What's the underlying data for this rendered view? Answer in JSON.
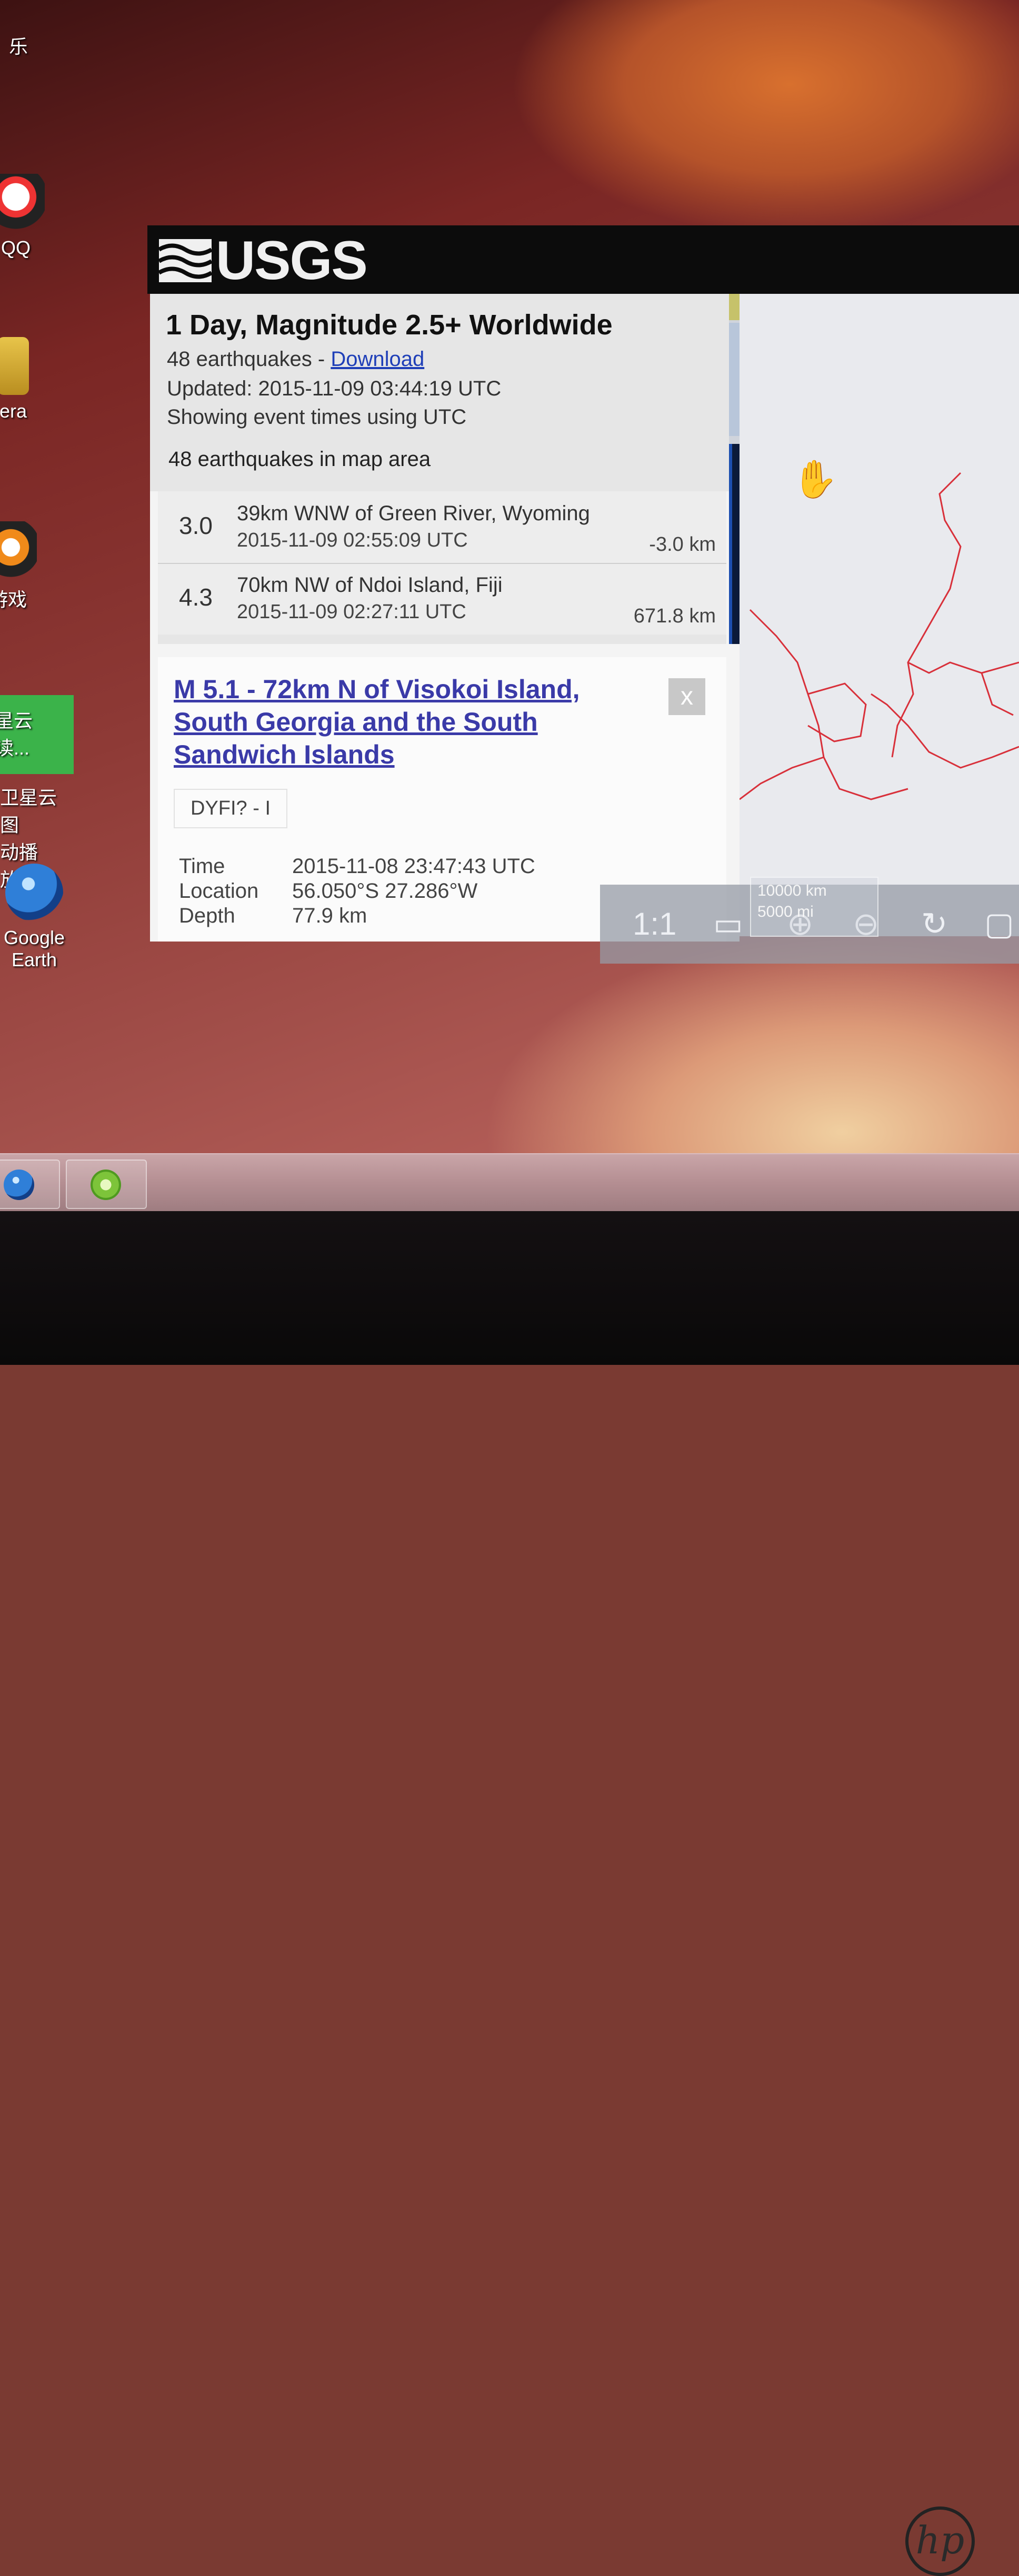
{
  "header": {
    "logo_text": "USGS"
  },
  "summary": {
    "title": "1 Day, Magnitude 2.5+ Worldwide",
    "count_text": "48 earthquakes - ",
    "download_label": "Download",
    "updated": "Updated: 2015-11-09 03:44:19 UTC",
    "timezone_note": "Showing event times using UTC",
    "map_area_count": "48 earthquakes in map area"
  },
  "events": [
    {
      "mag": "3.0",
      "place": "39km WNW of Green River, Wyoming",
      "time": "2015-11-09 02:55:09 UTC",
      "depth": "-3.0 km"
    },
    {
      "mag": "4.3",
      "place": "70km NW of Ndoi Island, Fiji",
      "time": "2015-11-09 02:27:11 UTC",
      "depth": "671.8 km"
    }
  ],
  "popup": {
    "title": "M 5.1 - 72km N of Visokoi Island, South Georgia and the South Sandwich Islands",
    "close_label": "x",
    "dyfi": "DYFI? - I",
    "time_label": "Time",
    "time_value": "2015-11-08 23:47:43 UTC",
    "location_label": "Location",
    "location_value": "56.050°S 27.286°W",
    "depth_label": "Depth",
    "depth_value": "77.9 km"
  },
  "map_controls": {
    "one_to_one": "1:1",
    "scale_km": "10000 km",
    "scale_mi": "5000 mi"
  },
  "desktop_icons": {
    "icon1": "乐",
    "icon2": "QQ",
    "icon3": "era",
    "icon4": "游戏",
    "icon5_line1": "星云",
    "icon5_line2": "读...",
    "icon6_line1": "卫星云图",
    "icon6_line2": "动播放'",
    "icon7_line1": "Google",
    "icon7_line2": "Earth"
  },
  "colors": {
    "usgs_header": "#0c0c0c",
    "link": "#1f3fb8",
    "plate_boundary": "#d8303a"
  }
}
